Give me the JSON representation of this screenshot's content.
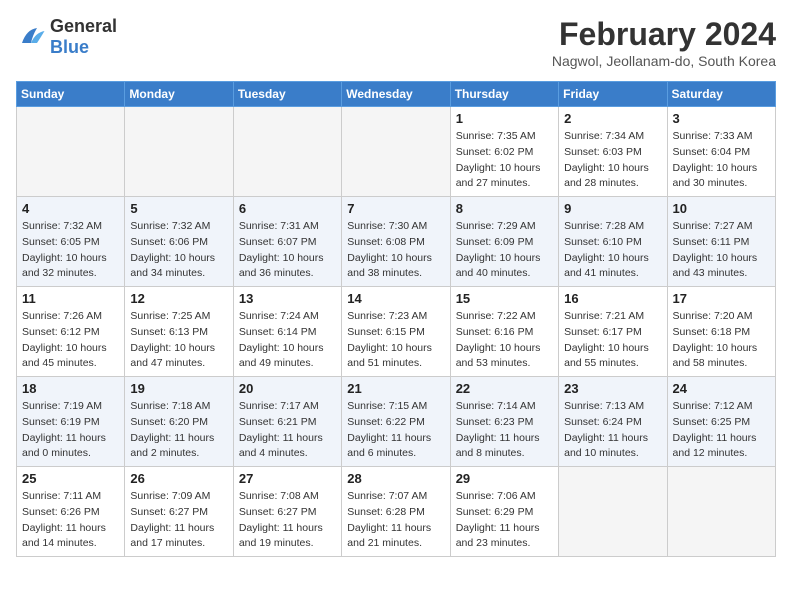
{
  "logo": {
    "line1": "General",
    "line2": "Blue"
  },
  "title": "February 2024",
  "location": "Nagwol, Jeollanam-do, South Korea",
  "weekdays": [
    "Sunday",
    "Monday",
    "Tuesday",
    "Wednesday",
    "Thursday",
    "Friday",
    "Saturday"
  ],
  "weeks": [
    [
      {
        "day": "",
        "info": ""
      },
      {
        "day": "",
        "info": ""
      },
      {
        "day": "",
        "info": ""
      },
      {
        "day": "",
        "info": ""
      },
      {
        "day": "1",
        "info": "Sunrise: 7:35 AM\nSunset: 6:02 PM\nDaylight: 10 hours\nand 27 minutes."
      },
      {
        "day": "2",
        "info": "Sunrise: 7:34 AM\nSunset: 6:03 PM\nDaylight: 10 hours\nand 28 minutes."
      },
      {
        "day": "3",
        "info": "Sunrise: 7:33 AM\nSunset: 6:04 PM\nDaylight: 10 hours\nand 30 minutes."
      }
    ],
    [
      {
        "day": "4",
        "info": "Sunrise: 7:32 AM\nSunset: 6:05 PM\nDaylight: 10 hours\nand 32 minutes."
      },
      {
        "day": "5",
        "info": "Sunrise: 7:32 AM\nSunset: 6:06 PM\nDaylight: 10 hours\nand 34 minutes."
      },
      {
        "day": "6",
        "info": "Sunrise: 7:31 AM\nSunset: 6:07 PM\nDaylight: 10 hours\nand 36 minutes."
      },
      {
        "day": "7",
        "info": "Sunrise: 7:30 AM\nSunset: 6:08 PM\nDaylight: 10 hours\nand 38 minutes."
      },
      {
        "day": "8",
        "info": "Sunrise: 7:29 AM\nSunset: 6:09 PM\nDaylight: 10 hours\nand 40 minutes."
      },
      {
        "day": "9",
        "info": "Sunrise: 7:28 AM\nSunset: 6:10 PM\nDaylight: 10 hours\nand 41 minutes."
      },
      {
        "day": "10",
        "info": "Sunrise: 7:27 AM\nSunset: 6:11 PM\nDaylight: 10 hours\nand 43 minutes."
      }
    ],
    [
      {
        "day": "11",
        "info": "Sunrise: 7:26 AM\nSunset: 6:12 PM\nDaylight: 10 hours\nand 45 minutes."
      },
      {
        "day": "12",
        "info": "Sunrise: 7:25 AM\nSunset: 6:13 PM\nDaylight: 10 hours\nand 47 minutes."
      },
      {
        "day": "13",
        "info": "Sunrise: 7:24 AM\nSunset: 6:14 PM\nDaylight: 10 hours\nand 49 minutes."
      },
      {
        "day": "14",
        "info": "Sunrise: 7:23 AM\nSunset: 6:15 PM\nDaylight: 10 hours\nand 51 minutes."
      },
      {
        "day": "15",
        "info": "Sunrise: 7:22 AM\nSunset: 6:16 PM\nDaylight: 10 hours\nand 53 minutes."
      },
      {
        "day": "16",
        "info": "Sunrise: 7:21 AM\nSunset: 6:17 PM\nDaylight: 10 hours\nand 55 minutes."
      },
      {
        "day": "17",
        "info": "Sunrise: 7:20 AM\nSunset: 6:18 PM\nDaylight: 10 hours\nand 58 minutes."
      }
    ],
    [
      {
        "day": "18",
        "info": "Sunrise: 7:19 AM\nSunset: 6:19 PM\nDaylight: 11 hours\nand 0 minutes."
      },
      {
        "day": "19",
        "info": "Sunrise: 7:18 AM\nSunset: 6:20 PM\nDaylight: 11 hours\nand 2 minutes."
      },
      {
        "day": "20",
        "info": "Sunrise: 7:17 AM\nSunset: 6:21 PM\nDaylight: 11 hours\nand 4 minutes."
      },
      {
        "day": "21",
        "info": "Sunrise: 7:15 AM\nSunset: 6:22 PM\nDaylight: 11 hours\nand 6 minutes."
      },
      {
        "day": "22",
        "info": "Sunrise: 7:14 AM\nSunset: 6:23 PM\nDaylight: 11 hours\nand 8 minutes."
      },
      {
        "day": "23",
        "info": "Sunrise: 7:13 AM\nSunset: 6:24 PM\nDaylight: 11 hours\nand 10 minutes."
      },
      {
        "day": "24",
        "info": "Sunrise: 7:12 AM\nSunset: 6:25 PM\nDaylight: 11 hours\nand 12 minutes."
      }
    ],
    [
      {
        "day": "25",
        "info": "Sunrise: 7:11 AM\nSunset: 6:26 PM\nDaylight: 11 hours\nand 14 minutes."
      },
      {
        "day": "26",
        "info": "Sunrise: 7:09 AM\nSunset: 6:27 PM\nDaylight: 11 hours\nand 17 minutes."
      },
      {
        "day": "27",
        "info": "Sunrise: 7:08 AM\nSunset: 6:27 PM\nDaylight: 11 hours\nand 19 minutes."
      },
      {
        "day": "28",
        "info": "Sunrise: 7:07 AM\nSunset: 6:28 PM\nDaylight: 11 hours\nand 21 minutes."
      },
      {
        "day": "29",
        "info": "Sunrise: 7:06 AM\nSunset: 6:29 PM\nDaylight: 11 hours\nand 23 minutes."
      },
      {
        "day": "",
        "info": ""
      },
      {
        "day": "",
        "info": ""
      }
    ]
  ]
}
